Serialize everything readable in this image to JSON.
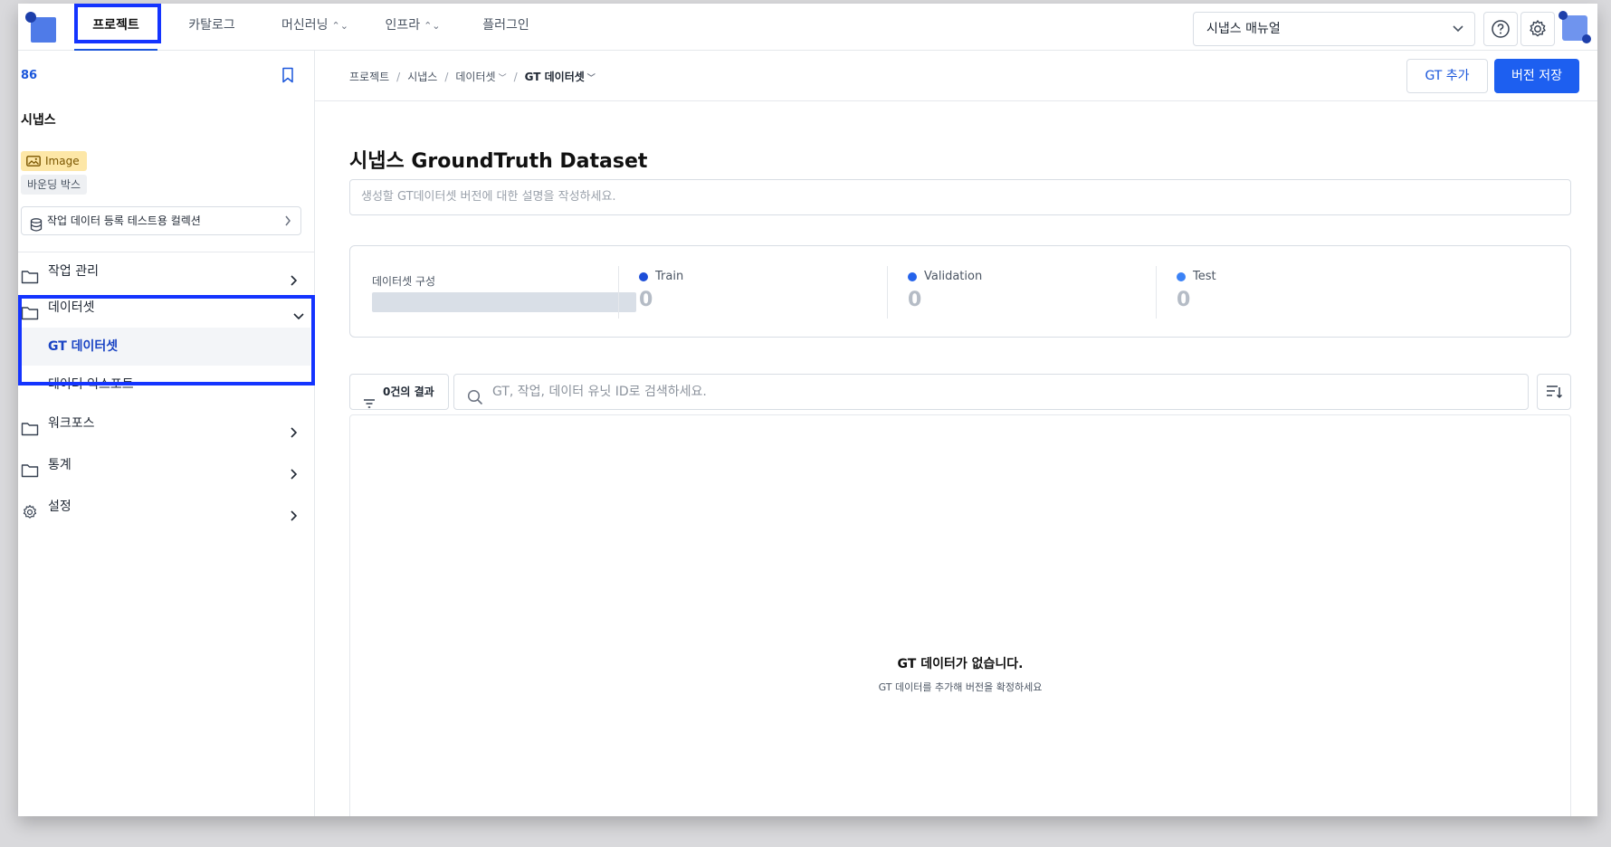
{
  "nav": {
    "tabs": [
      {
        "label": "프로젝트",
        "caret": ""
      },
      {
        "label": "카탈로그",
        "caret": ""
      },
      {
        "label": "머신러닝",
        "caret": "⌃⌄"
      },
      {
        "label": "인프라",
        "caret": "⌃⌄"
      },
      {
        "label": "플러그인",
        "caret": ""
      }
    ],
    "manual_select": "시냅스 매뉴얼"
  },
  "sidebar": {
    "project_id": "86",
    "project_name": "시냅스",
    "tag_type": "Image",
    "tag_annotation": "바운딩 박스",
    "collection_label": "작업 데이터 등록 테스트용 컬렉션",
    "menu": {
      "task_mgmt": "작업 관리",
      "dataset": "데이터셋",
      "gt_dataset": "GT 데이터셋",
      "data_export": "데이터 익스포트",
      "workforce": "워크포스",
      "stats": "통계",
      "settings": "설정"
    }
  },
  "breadcrumb": {
    "items": [
      "프로젝트",
      "시냅스",
      "데이터셋",
      "GT 데이터셋"
    ],
    "sep": "/"
  },
  "header": {
    "add_gt": "GT 추가",
    "save_version": "버전 저장"
  },
  "main": {
    "title": "시냅스 GroundTruth Dataset",
    "description_placeholder": "생성할 GT데이터셋 버전에 대한 설명을 작성하세요.",
    "stats": {
      "composition_label": "데이터셋 구성",
      "train": {
        "label": "Train",
        "value": "0",
        "color": "#1d4ed8"
      },
      "validation": {
        "label": "Validation",
        "value": "0",
        "color": "#2563eb"
      },
      "test": {
        "label": "Test",
        "value": "0",
        "color": "#3b82f6"
      }
    },
    "result_count": "0건의 결과",
    "search_placeholder": "GT, 작업, 데이터 유닛 ID로 검색하세요.",
    "empty_title": "GT 데이터가 없습니다.",
    "empty_subtitle": "GT 데이터를 추가해 버전을 확정하세요"
  },
  "colors": {
    "accent": "#1d5ff0",
    "highlight": "#1434ff"
  }
}
